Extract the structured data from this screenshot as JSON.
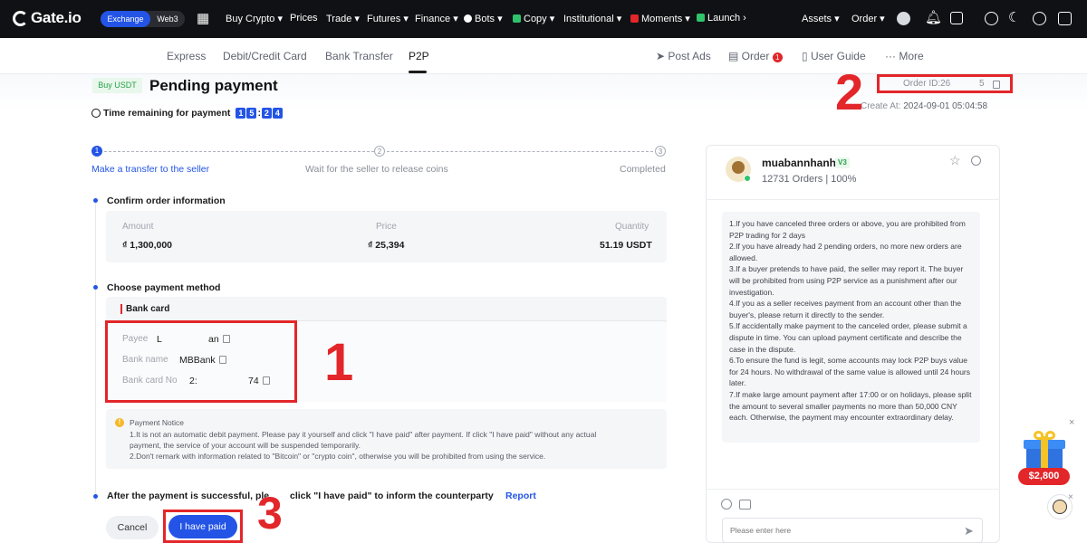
{
  "topnav": {
    "logo": "Gate.io",
    "exchange": "Exchange",
    "web3": "Web3",
    "items": [
      "Buy Crypto",
      "Prices",
      "Trade",
      "Futures",
      "Finance",
      "Bots",
      "Copy",
      "Institutional",
      "Moments",
      "Launch"
    ],
    "assets": "Assets",
    "order": "Order"
  },
  "subnav": {
    "tabs": [
      "Express",
      "Debit/Credit Card",
      "Bank Transfer",
      "P2P"
    ],
    "post_ads": "Post Ads",
    "order": "Order",
    "order_badge": "1",
    "user_guide": "User Guide",
    "more": "More"
  },
  "header": {
    "tag": "Buy USDT",
    "title": "Pending payment",
    "timer_label": "Time remaining for payment",
    "timer_digits": [
      "1",
      "5",
      "2",
      "4"
    ],
    "order_id": "Order ID:26",
    "order_id_tail": "5",
    "create_label": "Create At:",
    "create_value": "2024-09-01 05:04:58"
  },
  "steps": {
    "items": [
      {
        "num": "1",
        "label": "Make a transfer to the seller"
      },
      {
        "num": "2",
        "label": "Wait for the seller to release coins"
      },
      {
        "num": "3",
        "label": "Completed"
      }
    ]
  },
  "confirm": {
    "heading": "Confirm order information",
    "amount_label": "Amount",
    "amount_value": "₫ 1,300,000",
    "price_label": "Price",
    "price_value": "₫ 25,394",
    "qty_label": "Quantity",
    "qty_value": "51.19 USDT"
  },
  "payment": {
    "heading": "Choose payment method",
    "method_tab": "Bank card",
    "payee_label": "Payee",
    "payee_value": "L",
    "payee_tail": "an",
    "bank_label": "Bank name",
    "bank_value": "MBBank",
    "card_label": "Bank card No",
    "card_value": "2:",
    "card_tail": "74"
  },
  "notice": {
    "title": "Payment Notice",
    "line1": "1.It is not an automatic debit payment. Please pay it yourself and click \"I have paid\" after payment. If click \"I have paid\" without any actual",
    "line2": "payment, the service of your account will be suspended temporarily.",
    "line3": "2.Don't remark with information related to \"Bitcoin\" or \"crypto coin\", otherwise you will be prohibited from using the service."
  },
  "after": {
    "text_a": "After the payment is successful, ple",
    "text_b": "click \"I have paid\" to inform the counterparty",
    "report": "Report",
    "cancel": "Cancel",
    "paid": "I have paid"
  },
  "annotations": {
    "n1": "1",
    "n2": "2",
    "n3": "3"
  },
  "seller": {
    "name": "muabannhanh",
    "badge": "V3",
    "stats": "12731 Orders | 100%"
  },
  "rules": [
    "1.If you have canceled three orders or above, you are prohibited from P2P trading for 2 days",
    "2.If you have already had 2 pending orders, no more new orders are allowed.",
    "3.If a buyer pretends to have paid, the seller may report it. The buyer will be prohibited from using P2P service as a punishment after our investigation.",
    "4.If you as a seller receives payment from an account other than the buyer's, please return it directly to the sender.",
    "5.If accidentally make payment to the canceled order, please submit a dispute in time. You can upload payment certificate and describe the case in the dispute.",
    "6.To ensure the fund is legit, some accounts may lock P2P buys value for 24 hours. No withdrawal of the same value is allowed until 24 hours later.",
    "7.If make large amount payment after 17:00 or on holidays, please split the amount to several smaller payments no more than 50,000 CNY each. Otherwise, the payment may encounter extraordinary delay."
  ],
  "chat": {
    "placeholder": "Please enter here"
  },
  "gift": {
    "amount": "$2,800"
  },
  "colors": {
    "accent": "#2354e6",
    "annotation": "#e3262a",
    "topbar": "#101114"
  }
}
